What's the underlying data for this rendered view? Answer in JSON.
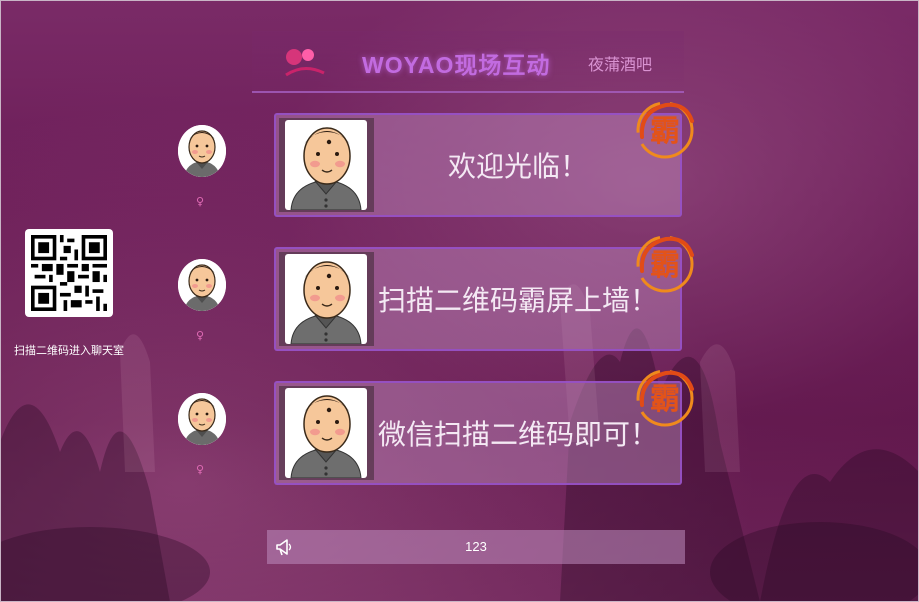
{
  "header": {
    "title": "WOYAO现场互动",
    "venue": "夜蒲酒吧",
    "logo_icon": "woyao-logo-icon"
  },
  "qr": {
    "caption": "扫描二维码进入聊天室",
    "icon": "qr-code-icon"
  },
  "messages": [
    {
      "text": "欢迎光临！",
      "gender": "♀",
      "avatar_icon": "cartoon-avatar-icon",
      "badge_icon": "ba-stamp-icon"
    },
    {
      "text": "扫描二维码霸屏上墙！",
      "gender": "♀",
      "avatar_icon": "cartoon-avatar-icon",
      "badge_icon": "ba-stamp-icon"
    },
    {
      "text": "微信扫描二维码即可！",
      "gender": "♀",
      "avatar_icon": "cartoon-avatar-icon",
      "badge_icon": "ba-stamp-icon"
    }
  ],
  "ticker": {
    "text": "123",
    "icon": "megaphone-icon"
  },
  "colors": {
    "accent_purple": "#c26be0",
    "gender_pink": "#e06bb5",
    "background": "#6a1c56"
  }
}
